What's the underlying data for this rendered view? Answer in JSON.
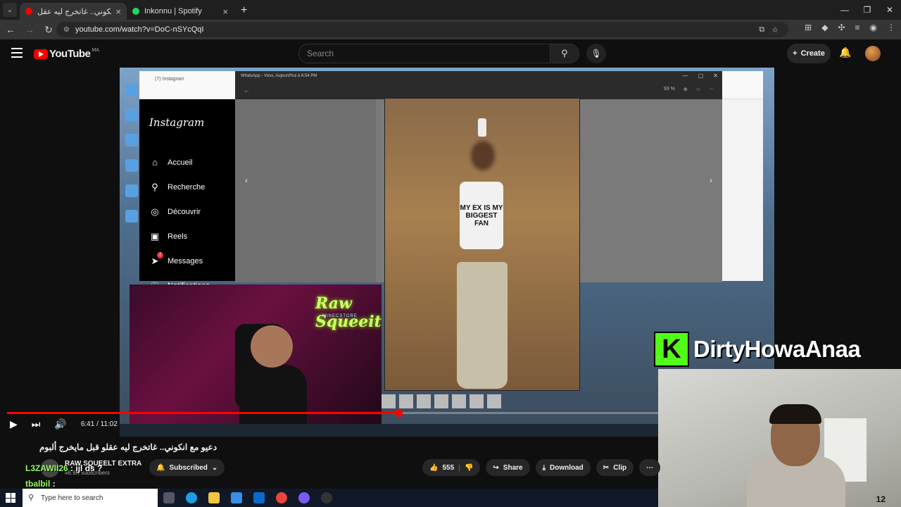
{
  "browser": {
    "tabs": [
      {
        "title": "دعيو مع انكوني.. غاتخرج ليه عقل",
        "color": "#ff0000"
      },
      {
        "title": "Inkonnu | Spotify",
        "color": "#1ed760"
      }
    ],
    "url": "youtube.com/watch?v=DoC-nSYcQqI"
  },
  "youtube": {
    "logo": "YouTube",
    "region": "MA",
    "search_placeholder": "Search",
    "create_label": "Create"
  },
  "player": {
    "current_time": "6:41",
    "duration": "11:02",
    "time_display": "6:41 / 11:02",
    "progress": 0.6
  },
  "stream": {
    "instagram": {
      "tab": "(7) Instagram",
      "logo": "Instagram",
      "menu": [
        "Accueil",
        "Recherche",
        "Découvrir",
        "Reels",
        "Messages",
        "Notifications"
      ],
      "messages_badge": "7"
    },
    "whatsapp": {
      "title": "WhatsApp - Vous, Aujourd'hui à 6:54 PM",
      "zoom": "93 %",
      "shirt_text": "MY EX IS MY BIGGEST FAN"
    },
    "neon_sign": "Raw Squeeit",
    "neon_sub": "MINECSTORE"
  },
  "overlay": {
    "kick_letter": "K",
    "kick_name": "DirtyHowaAnaa",
    "corner_mark": "12"
  },
  "video": {
    "title": "دعيو مع انكوني.. غاتخرج ليه عقلو قبل مايخرج ألبوم",
    "channel": "RAW SQUEELT EXTRA",
    "subscribers": "46.9K subscribers",
    "subscribed_label": "Subscribed",
    "likes": "555",
    "share_label": "Share",
    "download_label": "Download",
    "clip_label": "Clip"
  },
  "chat": [
    {
      "user": "L3ZAWII26",
      "text": ": ijl ds ?"
    },
    {
      "user": "tbalbil",
      "text": ":"
    }
  ],
  "taskbar": {
    "search_placeholder": "Type here to search"
  }
}
